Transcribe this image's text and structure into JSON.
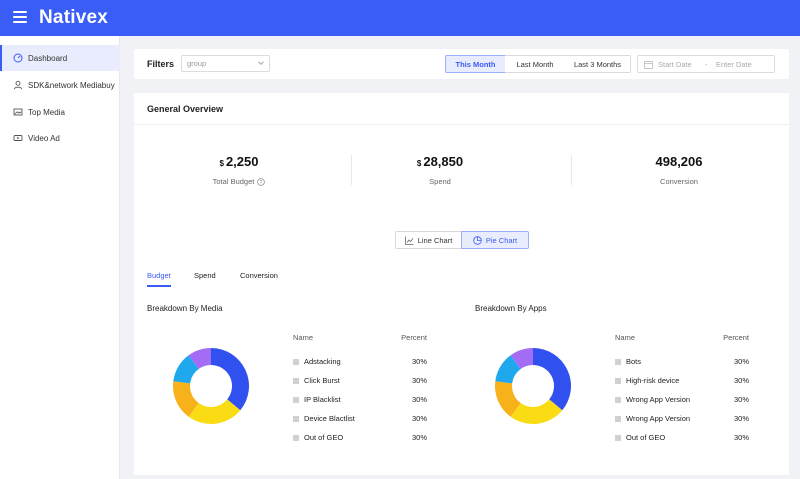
{
  "app": {
    "logo": "Nativex"
  },
  "sidebar": {
    "items": [
      {
        "label": "Dashboard",
        "icon": "gauge-icon"
      },
      {
        "label": "SDK&network Mediabuy",
        "icon": "user-icon"
      },
      {
        "label": "Top Media",
        "icon": "image-icon"
      },
      {
        "label": "Video Ad",
        "icon": "video-icon"
      }
    ]
  },
  "filters": {
    "label": "Filters",
    "group_placeholder": "group",
    "range_options": [
      "This Month",
      "Last Month",
      "Last 3 Months"
    ],
    "selected_range": "This Month",
    "start_placeholder": "Start Date",
    "separator": "-",
    "end_placeholder": "Enter Date"
  },
  "overview": {
    "title": "General Overview",
    "kpis": [
      {
        "currency": "$",
        "value": "2,250",
        "label": "Total Budget"
      },
      {
        "currency": "$",
        "value": "28,850",
        "label": "Spend"
      },
      {
        "currency": "",
        "value": "498,206",
        "label": "Conversion"
      }
    ],
    "chart_toggle": {
      "line": "Line Chart",
      "pie": "Pie Chart",
      "selected": "Pie Chart"
    },
    "tabs": [
      "Budget",
      "Spend",
      "Conversion"
    ],
    "selected_tab": "Budget"
  },
  "breakdowns": [
    {
      "title": "Breakdown By Media",
      "col_name": "Name",
      "col_percent": "Percent",
      "rows": [
        {
          "name": "Adstacking",
          "percent": "30%"
        },
        {
          "name": "Click Burst",
          "percent": "30%"
        },
        {
          "name": "IP Blacklist",
          "percent": "30%"
        },
        {
          "name": "Device Blactlist",
          "percent": "30%"
        },
        {
          "name": "Out of GEO",
          "percent": "30%"
        }
      ]
    },
    {
      "title": "Breakdown By Apps",
      "col_name": "Name",
      "col_percent": "Percent",
      "rows": [
        {
          "name": "Bots",
          "percent": "30%"
        },
        {
          "name": "High-risk device",
          "percent": "30%"
        },
        {
          "name": "Wrong App Version",
          "percent": "30%"
        },
        {
          "name": "Wrong App Version",
          "percent": "30%"
        },
        {
          "name": "Out of GEO",
          "percent": "30%"
        }
      ]
    }
  ],
  "donut_segments": [
    {
      "color": "#3050f0",
      "share": 0.36
    },
    {
      "color": "#fadc14",
      "share": 0.24
    },
    {
      "color": "#f7b11b",
      "share": 0.17
    },
    {
      "color": "#20a8ee",
      "share": 0.13
    },
    {
      "color": "#a36cf5",
      "share": 0.1
    }
  ],
  "colors": {
    "accent": "#3a5cf7",
    "accent_light": "#e8ecfd"
  }
}
